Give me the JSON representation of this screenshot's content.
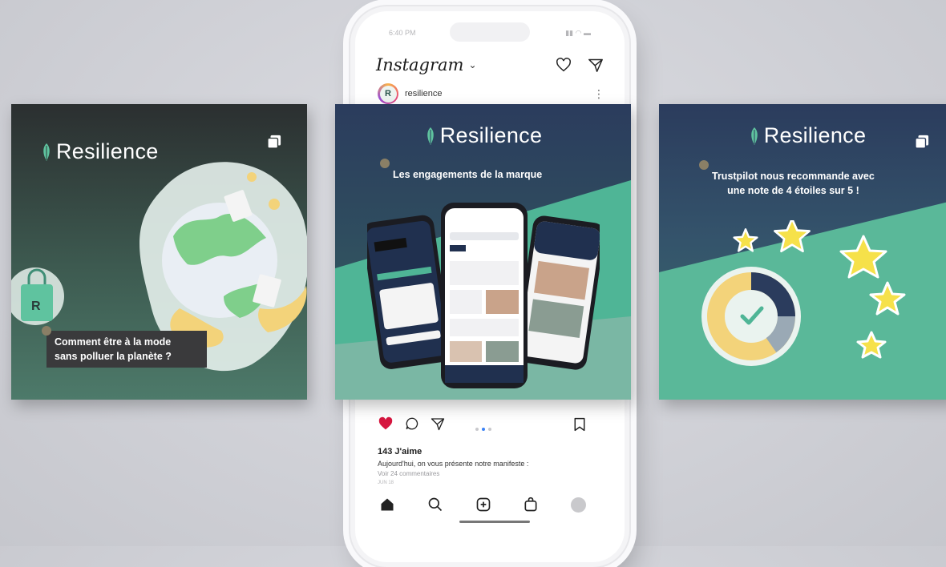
{
  "phone": {
    "status_time": "6:40 PM",
    "app_title": "Instagram",
    "account_name": "resilience",
    "avatar_letter": "R",
    "likes": "143 J'aime",
    "caption": "Aujourd'hui, on vous présente notre manifeste :",
    "comments": "Voir 24 commentaires",
    "date": "JUN 18"
  },
  "cards": {
    "left": {
      "brand": "Resilience",
      "caption_line1": "Comment être à la mode",
      "caption_line2": "sans polluer la planète ?"
    },
    "center": {
      "brand": "Resilience",
      "caption_line1": "Les engagements de la marque"
    },
    "right": {
      "brand": "Resilience",
      "caption_line1": "Trustpilot nous recommande avec",
      "caption_line2": "une note de 4 étoiles sur 5 !"
    }
  },
  "colors": {
    "brand_green": "#4fb596",
    "navy": "#2b3c5d",
    "star_yellow": "#f6e14a",
    "like_red": "#e0245e"
  },
  "icons": [
    "heart-icon",
    "paper-plane-icon",
    "comment-icon",
    "share-icon",
    "bookmark-icon",
    "home-icon",
    "search-icon",
    "add-post-icon",
    "shop-icon",
    "profile-icon",
    "multi-post-icon",
    "star-icon"
  ]
}
